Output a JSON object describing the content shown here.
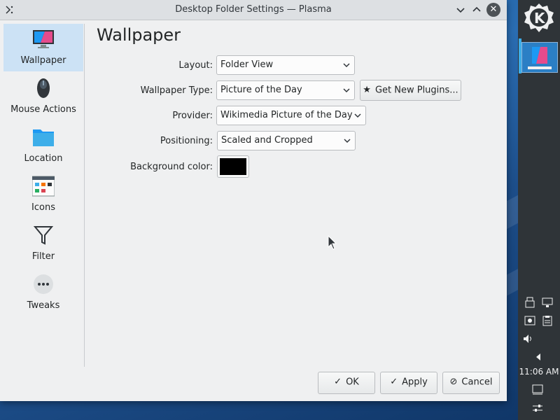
{
  "window": {
    "title": "Desktop Folder Settings — Plasma"
  },
  "sidebar": {
    "items": [
      {
        "label": "Wallpaper",
        "icon": "monitor-icon",
        "selected": true
      },
      {
        "label": "Mouse Actions",
        "icon": "mouse-icon",
        "selected": false
      },
      {
        "label": "Location",
        "icon": "folder-icon",
        "selected": false
      },
      {
        "label": "Icons",
        "icon": "icons-grid-icon",
        "selected": false
      },
      {
        "label": "Filter",
        "icon": "funnel-icon",
        "selected": false
      },
      {
        "label": "Tweaks",
        "icon": "more-dots-icon",
        "selected": false
      }
    ]
  },
  "main": {
    "title": "Wallpaper",
    "layout": {
      "label": "Layout:",
      "value": "Folder View"
    },
    "wallpaper_type": {
      "label": "Wallpaper Type:",
      "value": "Picture of the Day"
    },
    "get_plugins": "Get New Plugins...",
    "provider": {
      "label": "Provider:",
      "value": "Wikimedia Picture of the Day"
    },
    "positioning": {
      "label": "Positioning:",
      "value": "Scaled and Cropped"
    },
    "background_color": {
      "label": "Background color:",
      "value": "#000000"
    }
  },
  "buttons": {
    "ok": "OK",
    "apply": "Apply",
    "cancel": "Cancel"
  },
  "panel": {
    "clock": "11:06 AM"
  },
  "colors": {
    "selection": "#cce2f5",
    "accent": "#3daee9",
    "panel": "#2f3438"
  }
}
